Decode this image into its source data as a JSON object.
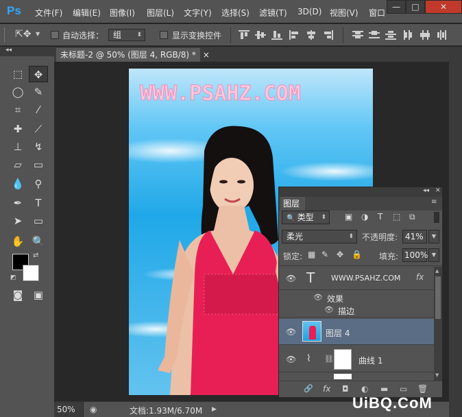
{
  "app": {
    "logo": "Ps"
  },
  "menu": {
    "items": [
      "文件(F)",
      "编辑(E)",
      "图像(I)",
      "图层(L)",
      "文字(Y)",
      "选择(S)",
      "滤镜(T)",
      "3D(D)",
      "视图(V)",
      "窗口"
    ]
  },
  "window_controls": {
    "minimize": "—",
    "restore": "□",
    "close": "✕"
  },
  "options": {
    "auto_select_label": "自动选择：",
    "auto_select_value": "组",
    "show_transform_label": "显示变换控件"
  },
  "document": {
    "tab_title": "未标题-2 @ 50% (图层 4, RGB/8) *",
    "close": "×",
    "watermark_text": "WWW.PSAHZ.COM"
  },
  "status": {
    "zoom": "50%",
    "doc_info": "文档:1.93M/6.70M"
  },
  "layers_panel": {
    "title": "图层",
    "filter_kind": "类型",
    "blend_mode": "柔光",
    "opacity_label": "不透明度:",
    "opacity_value": "41%",
    "lock_label": "锁定:",
    "fill_label": "填充:",
    "fill_value": "100%",
    "layers": [
      {
        "name": "WWW.PSAHZ.COM",
        "type": "text",
        "fx": "fx"
      },
      {
        "name": "效果",
        "type": "effects"
      },
      {
        "name": "描边",
        "type": "effect"
      },
      {
        "name": "图层 4",
        "type": "image",
        "selected": true
      },
      {
        "name": "曲线 1",
        "type": "adjustment"
      }
    ],
    "footer": [
      "🔗",
      "fx",
      "◘",
      "◐",
      "▬",
      "▭",
      "🗑"
    ]
  },
  "site_watermark": "UiBQ.CoM",
  "colors": {
    "accent": "#31a8ff",
    "selected_layer": "#5a6d85",
    "foreground": "#000000",
    "background": "#ffffff"
  }
}
